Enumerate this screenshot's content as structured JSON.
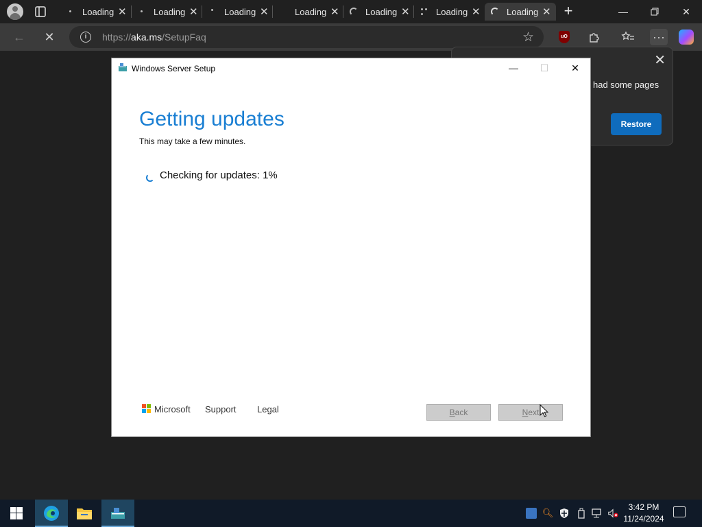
{
  "browser": {
    "tabs": [
      {
        "label": "Loading",
        "loading_style": "dot"
      },
      {
        "label": "Loading",
        "loading_style": "dot"
      },
      {
        "label": "Loading",
        "loading_style": "dot"
      },
      {
        "label": "Loading",
        "loading_style": "none"
      },
      {
        "label": "Loading",
        "loading_style": "spinner"
      },
      {
        "label": "Loading",
        "loading_style": "dots"
      },
      {
        "label": "Loading",
        "loading_style": "spinner",
        "active": true
      }
    ],
    "address": {
      "url_prefix": "https://",
      "url_host": "aka.ms",
      "url_path": "/SetupFaq"
    },
    "restore_popup": {
      "message": "had some pages",
      "button_label": "Restore"
    },
    "accent_color": "#0f6cbd"
  },
  "setup_window": {
    "title": "Windows Server Setup",
    "heading": "Getting updates",
    "subtitle": "This may take a few minutes.",
    "status": "Checking for updates: 1%",
    "progress_percent": 1,
    "footer": {
      "brand": "Microsoft",
      "links": [
        "Support",
        "Legal"
      ],
      "back_label": "Back",
      "back_accesskey": "B",
      "back_rest": "ack",
      "next_label": "Next",
      "next_accesskey": "N",
      "next_rest": "ext"
    },
    "heading_color": "#1a7fd3"
  },
  "taskbar": {
    "apps": [
      "start-icon",
      "edge-icon",
      "file-explorer-icon",
      "windows-setup-icon"
    ],
    "clock": {
      "time": "3:42 PM",
      "date": "11/24/2024"
    }
  }
}
